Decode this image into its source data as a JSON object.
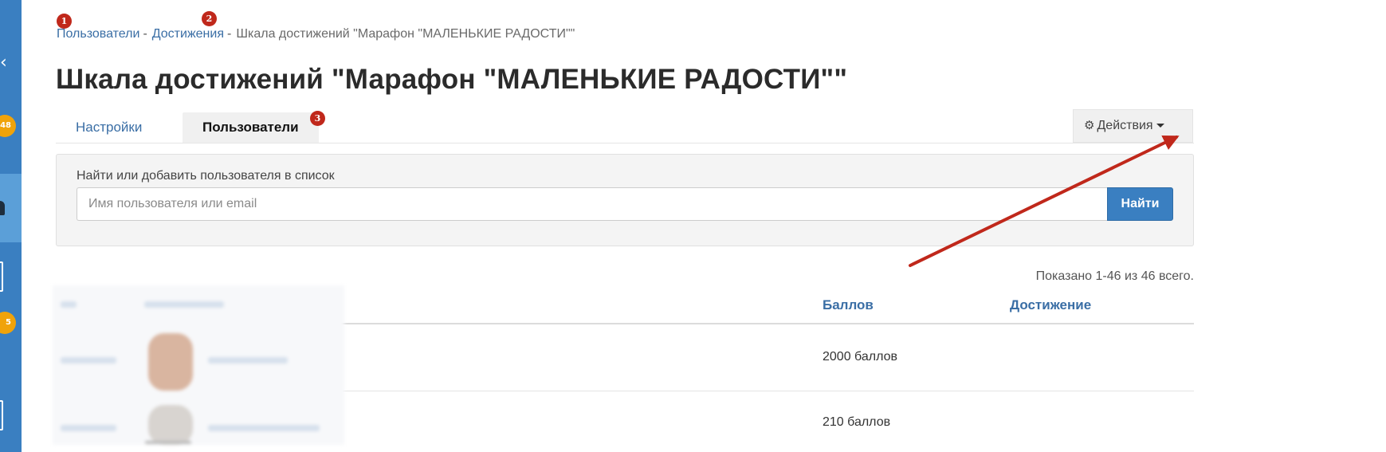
{
  "breadcrumb": {
    "item1": "Пользователи",
    "sep1": "-",
    "item2": "Достижения",
    "sep2": "-",
    "current": "Шкала достижений \"Марафон \"МАЛЕНЬКИЕ РАДОСТИ\"\""
  },
  "markers": {
    "m1": "1",
    "m2": "2",
    "m3": "3"
  },
  "page_title": "Шкала достижений \"Марафон \"МАЛЕНЬКИЕ РАДОСТИ\"\"",
  "tabs": [
    {
      "label": "Настройки",
      "active": false
    },
    {
      "label": "Пользователи",
      "active": true
    }
  ],
  "actions": {
    "label": "Действия",
    "icon": "gears-icon"
  },
  "search": {
    "label": "Найти или добавить пользователя в список",
    "placeholder": "Имя пользователя или email",
    "value": "",
    "button": "Найти"
  },
  "shown_text": "Показано 1-46 из 46 всего.",
  "table": {
    "columns": [
      "Баллов",
      "Достижение"
    ],
    "rows": [
      {
        "points": "2000 баллов",
        "achievement": ""
      },
      {
        "points": "210 баллов",
        "achievement": ""
      }
    ]
  },
  "sidebar": {
    "badges": [
      "48",
      "5"
    ]
  },
  "colors": {
    "accent": "#3a7fc1",
    "link": "#3a6ea5",
    "marker": "#c0281b",
    "arrow": "#c0281b",
    "badge": "#f0a30a"
  }
}
